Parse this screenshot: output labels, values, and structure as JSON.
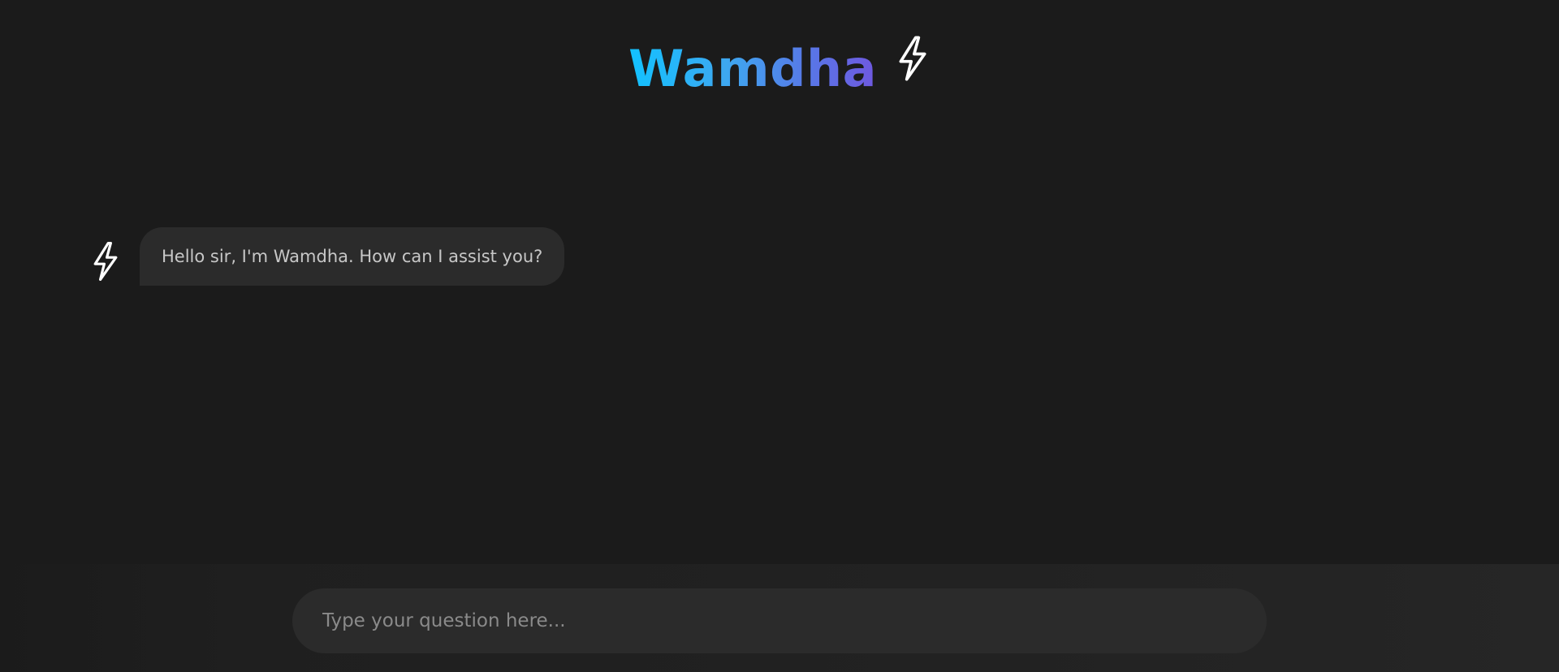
{
  "header": {
    "title": "Wamdha",
    "icon": "lightning-bolt-icon"
  },
  "messages": [
    {
      "sender": "bot",
      "avatar_icon": "lightning-bolt-icon",
      "text": "Hello sir, I'm Wamdha. How can I assist you?"
    }
  ],
  "composer": {
    "value": "",
    "placeholder": "Type your question here..."
  },
  "colors": {
    "background": "#1b1b1b",
    "bubble": "#2b2b2b",
    "input": "#2b2b2b",
    "title_gradient_start": "#12c2ff",
    "title_gradient_end": "#6f58e0",
    "icon": "#ffffff"
  }
}
